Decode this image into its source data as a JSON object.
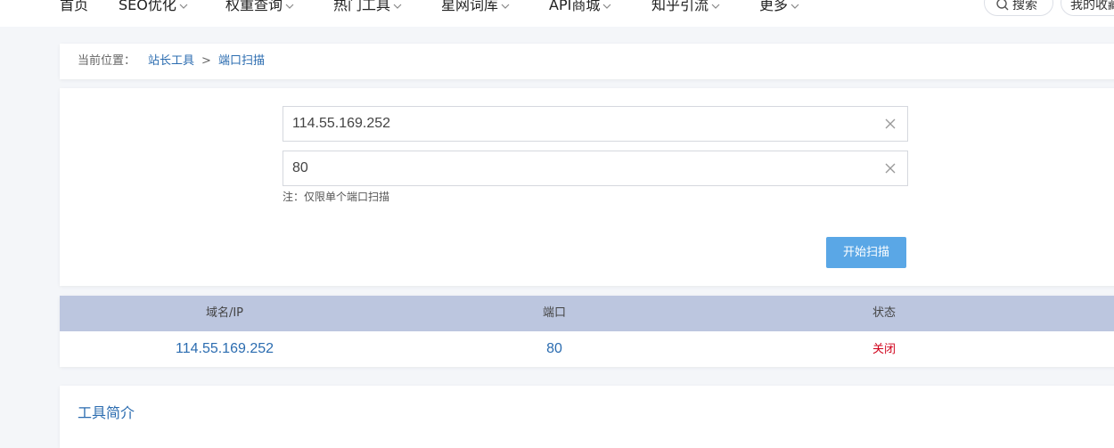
{
  "nav": {
    "items": [
      {
        "label": "首页",
        "has_dropdown": false
      },
      {
        "label": "SEO优化",
        "has_dropdown": true
      },
      {
        "label": "权重查询",
        "has_dropdown": true
      },
      {
        "label": "热门工具",
        "has_dropdown": true
      },
      {
        "label": "星网词库",
        "has_dropdown": true
      },
      {
        "label": "API商城",
        "has_dropdown": true
      },
      {
        "label": "知乎引流",
        "has_dropdown": true
      },
      {
        "label": "更多",
        "has_dropdown": true
      }
    ],
    "search_label": "搜索",
    "favorites_label": "我的收藏"
  },
  "breadcrumb": {
    "prefix": "当前位置：",
    "parent": "站长工具",
    "separator": ">",
    "current": "端口扫描"
  },
  "form": {
    "host_value": "114.55.169.252",
    "port_value": "80",
    "note": "注：仅限单个端口扫描",
    "submit_label": "开始扫描"
  },
  "results": {
    "columns": [
      "域名/IP",
      "端口",
      "状态"
    ],
    "rows": [
      {
        "host": "114.55.169.252",
        "port": "80",
        "status": "关闭"
      }
    ]
  },
  "intro": {
    "title": "工具简介"
  },
  "colors": {
    "accent": "#2b6cb0",
    "button": "#5aa7e6",
    "table_header": "#bcc6df",
    "status_closed": "#d0021b"
  }
}
